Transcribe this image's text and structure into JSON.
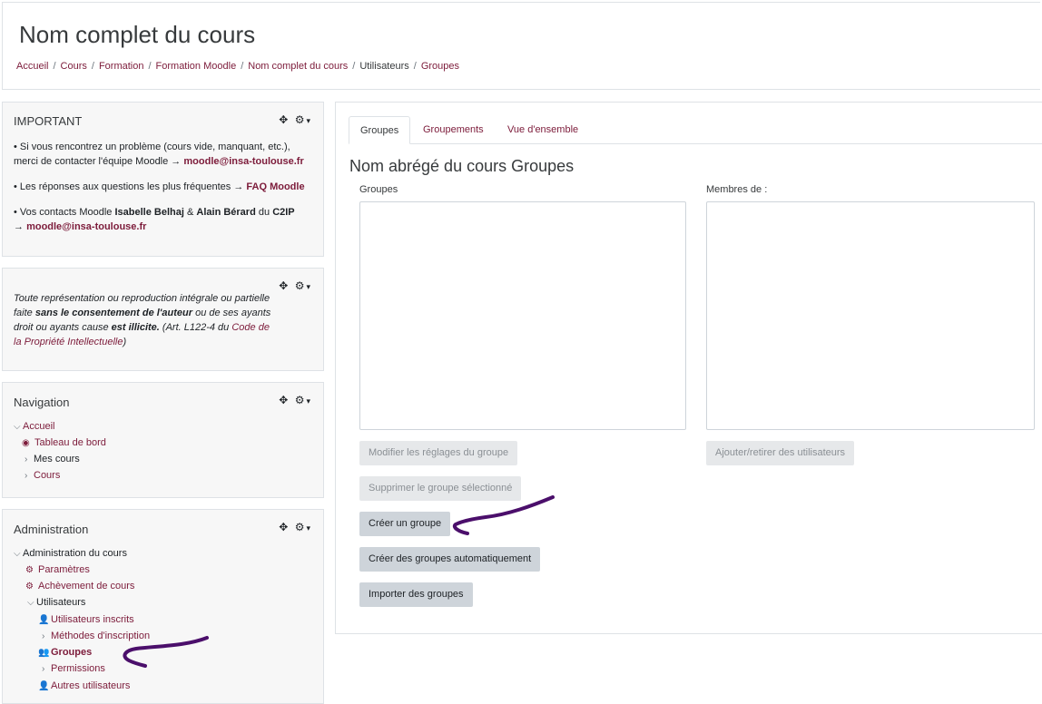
{
  "header": {
    "title": "Nom complet du cours",
    "breadcrumb": [
      "Accueil",
      "Cours",
      "Formation",
      "Formation Moodle",
      "Nom complet du cours",
      "Utilisateurs",
      "Groupes"
    ],
    "separator": "/"
  },
  "blocks": {
    "important": {
      "title": "IMPORTANT",
      "p1_text": "• Si vous rencontrez un problème (cours vide, manquant, etc.), merci de contacter l'équipe Moodle →",
      "p1_email": "moodle@insa-toulouse.fr",
      "p2_text": "• Les réponses aux questions les plus fréquentes →",
      "p2_link": "FAQ Moodle",
      "p3_prefix": "• Vos contacts Moodle",
      "p3_name1": "Isabelle Belhaj",
      "p3_amp": "&",
      "p3_name2": "Alain Bérard",
      "p3_du": "du",
      "p3_org": "C2IP",
      "p3_arrow": "→",
      "p3_email": "moodle@insa-toulouse.fr"
    },
    "copyright": {
      "t1": "Toute représentation ou reproduction intégrale ou partielle faite",
      "t2": "sans le consentement de l'auteur",
      "t3": "ou de ses ayants droit ou ayants cause",
      "t4": "est illicite.",
      "t5": "(Art. L122-4 du",
      "t6": "Code de la Propriété Intellectuelle",
      "t7": ")"
    },
    "navigation": {
      "title": "Navigation",
      "items": [
        "Accueil",
        "Tableau de bord",
        "Mes cours",
        "Cours"
      ]
    },
    "administration": {
      "title": "Administration",
      "items": [
        "Administration du cours",
        "Paramètres",
        "Achèvement de cours",
        "Utilisateurs",
        "Utilisateurs inscrits",
        "Méthodes d'inscription",
        "Groupes",
        "Permissions",
        "Autres utilisateurs"
      ]
    },
    "controls": {
      "move": "✥",
      "gear": "⚙",
      "caret": "▾"
    }
  },
  "main": {
    "tabs": [
      "Groupes",
      "Groupements",
      "Vue d'ensemble"
    ],
    "heading": "Nom abrégé du cours Groupes",
    "groups_label": "Groupes",
    "members_label": "Membres de :",
    "buttons": {
      "edit_group": "Modifier les réglages du groupe",
      "add_remove_users": "Ajouter/retirer des utilisateurs",
      "delete_group": "Supprimer le groupe sélectionné",
      "create_group": "Créer un groupe",
      "auto_create": "Créer des groupes automatiquement",
      "import_groups": "Importer des groupes"
    }
  },
  "colors": {
    "link": "#7c1b3a",
    "annotation": "#4b0f6b"
  }
}
